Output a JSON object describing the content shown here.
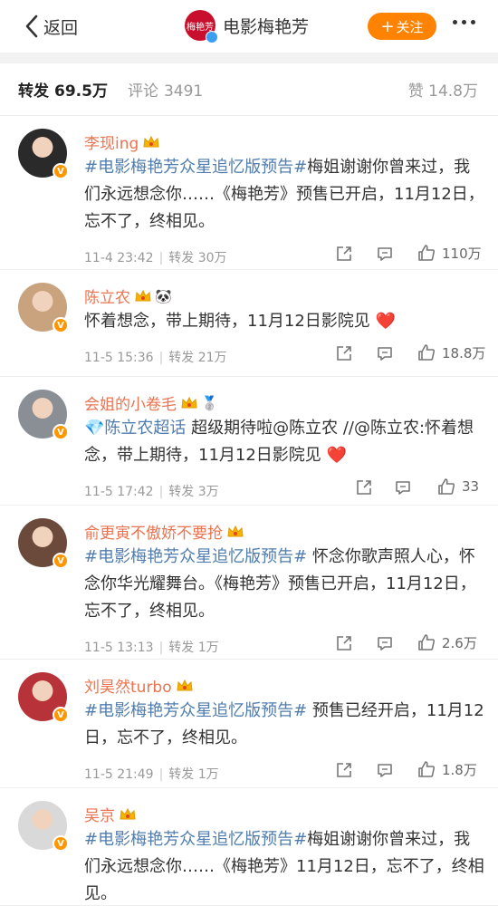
{
  "header": {
    "back_label": "返回",
    "title": "电影梅艳芳",
    "brand_logo_text": "梅艳芳",
    "follow_label": "关注"
  },
  "tabs": {
    "repost_label": "转发",
    "repost_count": "69.5万",
    "comment_label": "评论",
    "comment_count": "3491",
    "like_label": "赞",
    "like_count": "14.8万"
  },
  "reposts": [
    {
      "name": "李现ing",
      "tag": "#电影梅艳芳众星追忆版预告#",
      "text": "梅姐谢谢你曾来过，我们永远想念你……《梅艳芳》预售已开启，11月12日，忘不了，终相见。",
      "time": "11-4 23:42",
      "repost_text": "转发 30万",
      "likes": "110万",
      "avatar_color": "#2a2a2a"
    },
    {
      "name": "陈立农",
      "badge": "🐼",
      "text": "怀着想念，带上期待，11月12日影院见 ❤️",
      "time": "11-5 15:36",
      "repost_text": "转发 21万",
      "likes": "18.8万",
      "avatar_color": "#c9a27e"
    },
    {
      "name": "会姐的小卷毛",
      "badge": "🥈",
      "tag": "💎陈立农超话",
      "text": " 超级期待啦@陈立农 //@陈立农:怀着想念，带上期待，11月12日影院见 ❤️",
      "time": "11-5 17:42",
      "repost_text": "转发 3万",
      "likes": "33",
      "avatar_color": "#8a8f96"
    },
    {
      "name": "俞更寅不傲娇不要抢",
      "tag": "#电影梅艳芳众星追忆版预告#",
      "text": " 怀念你歌声照人心，怀念你华光耀舞台。《梅艳芳》预售已开启，11月12日，忘不了，终相见。",
      "time": "11-5 13:13",
      "repost_text": "转发 1万",
      "likes": "2.6万",
      "avatar_color": "#6b4a3c"
    },
    {
      "name": "刘昊然turbo",
      "tag": "#电影梅艳芳众星追忆版预告#",
      "text": " 预售已经开启，11月12日，忘不了，终相见。",
      "time": "11-5 21:49",
      "repost_text": "转发 1万",
      "likes": "1.8万",
      "avatar_color": "#b8323a"
    },
    {
      "name": "吴京",
      "tag": "#电影梅艳芳众星追忆版预告#",
      "text": "梅姐谢谢你曾来过，我们永远想念你……《梅艳芳》11月12日，忘不了，终相见。",
      "time": "",
      "repost_text": "",
      "likes": "",
      "avatar_color": "#d9d9d9"
    }
  ],
  "colors": {
    "accent_orange": "#ff8200",
    "name_color": "#eb7350",
    "link_color": "#507daf"
  }
}
